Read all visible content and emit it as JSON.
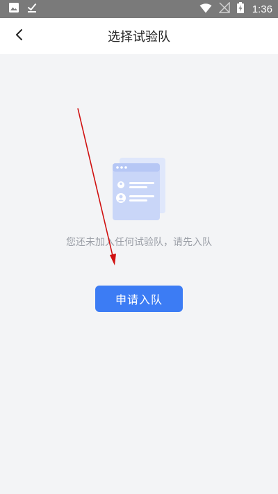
{
  "status_bar": {
    "time": "1:36",
    "icons": [
      "image-icon",
      "download-done-icon",
      "wifi-icon",
      "no-signal-icon",
      "battery-charging-icon"
    ]
  },
  "header": {
    "title": "选择试验队",
    "back_icon": "chevron-left-icon"
  },
  "empty_state": {
    "illustration": "profile-card-illustration",
    "message": "您还未加入任何试验队，请先入队",
    "apply_button_label": "申请入队"
  },
  "colors": {
    "status_bar_bg": "#7a7a7a",
    "page_bg": "#f3f4f6",
    "accent": "#3c7cf4",
    "illustration_fill": "#c9d6f8",
    "annotation_arrow": "#d01010"
  }
}
